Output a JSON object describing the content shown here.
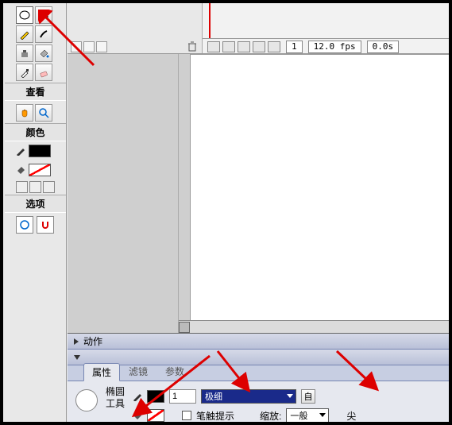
{
  "toolbox": {
    "sections": {
      "view": "查看",
      "colors": "颜色",
      "options": "选项"
    }
  },
  "timeline": {
    "frame": "1",
    "fps": "12.0 fps",
    "time": "0.0s"
  },
  "panels": {
    "actions": "动作",
    "properties_tabs": {
      "props": "属性",
      "filters": "滤镜",
      "params": "参数"
    }
  },
  "props": {
    "tool_name_l1": "椭圆",
    "tool_name_l2": "工具",
    "stroke_weight": "1",
    "stroke_style": "极细",
    "custom_btn": "自",
    "stroke_hint": "笔触提示",
    "scale_label": "缩放:",
    "scale_value": "一般",
    "cap_label": "尖"
  }
}
